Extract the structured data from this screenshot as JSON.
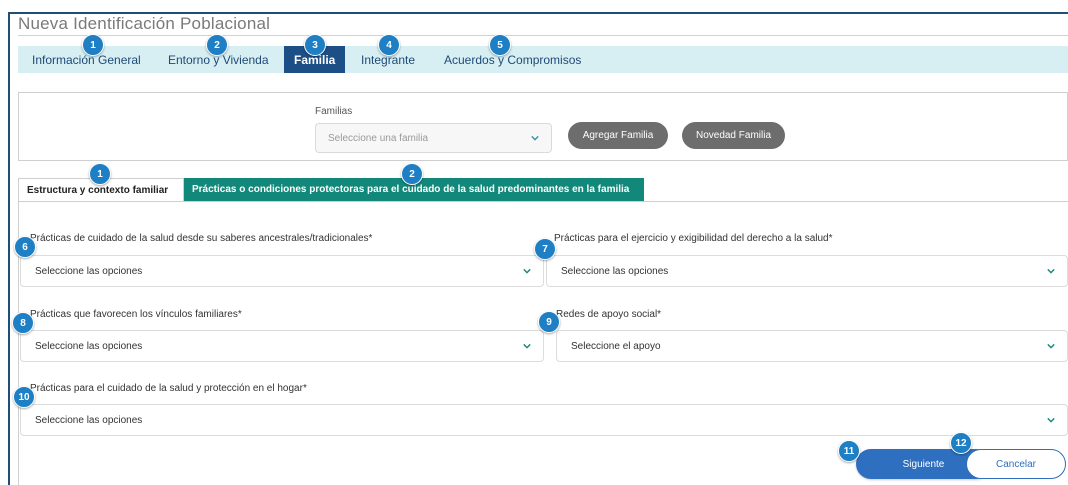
{
  "page_title": "Nueva Identificación Poblacional",
  "main_tabs": [
    {
      "label": "Información General",
      "badge": "1"
    },
    {
      "label": "Entorno y Vivienda",
      "badge": "2"
    },
    {
      "label": "Familia",
      "badge": "3"
    },
    {
      "label": "Integrante",
      "badge": "4"
    },
    {
      "label": "Acuerdos y Compromisos",
      "badge": "5"
    }
  ],
  "families": {
    "label": "Familias",
    "select_placeholder": "Seleccione una familia",
    "add_label": "Agregar Familia",
    "news_label": "Novedad Familia"
  },
  "sub_tabs": [
    {
      "label": "Estructura y contexto familiar",
      "badge": "1"
    },
    {
      "label": "Prácticas o condiciones protectoras para el cuidado de la salud predominantes en la familia",
      "badge": "2"
    }
  ],
  "fields": [
    {
      "badge": "6",
      "label": "Prácticas de cuidado de la salud desde su saberes ancestrales/tradicionales*",
      "placeholder": "Seleccione las opciones"
    },
    {
      "badge": "7",
      "label": "Prácticas para el ejercicio y exigibilidad del derecho a la salud*",
      "placeholder": "Seleccione las opciones"
    },
    {
      "badge": "8",
      "label": "Prácticas que favorecen los vínculos familiares*",
      "placeholder": "Seleccione las opciones"
    },
    {
      "badge": "9",
      "label": "Redes de apoyo social*",
      "placeholder": "Seleccione el apoyo"
    },
    {
      "badge": "10",
      "label": "Prácticas para el cuidado de la salud y protección en el hogar*",
      "placeholder": "Seleccione las opciones"
    }
  ],
  "actions": {
    "next_label": "Siguiente",
    "next_badge": "11",
    "cancel_label": "Cancelar",
    "cancel_badge": "12"
  },
  "colors": {
    "tab_bar_bg": "#d7eff2",
    "active_tab": "#1b4f86",
    "active_subtab": "#12887a",
    "badge": "#1e7fc4",
    "primary_button": "#2f6fbf",
    "pill_button": "#6d6d6d"
  }
}
